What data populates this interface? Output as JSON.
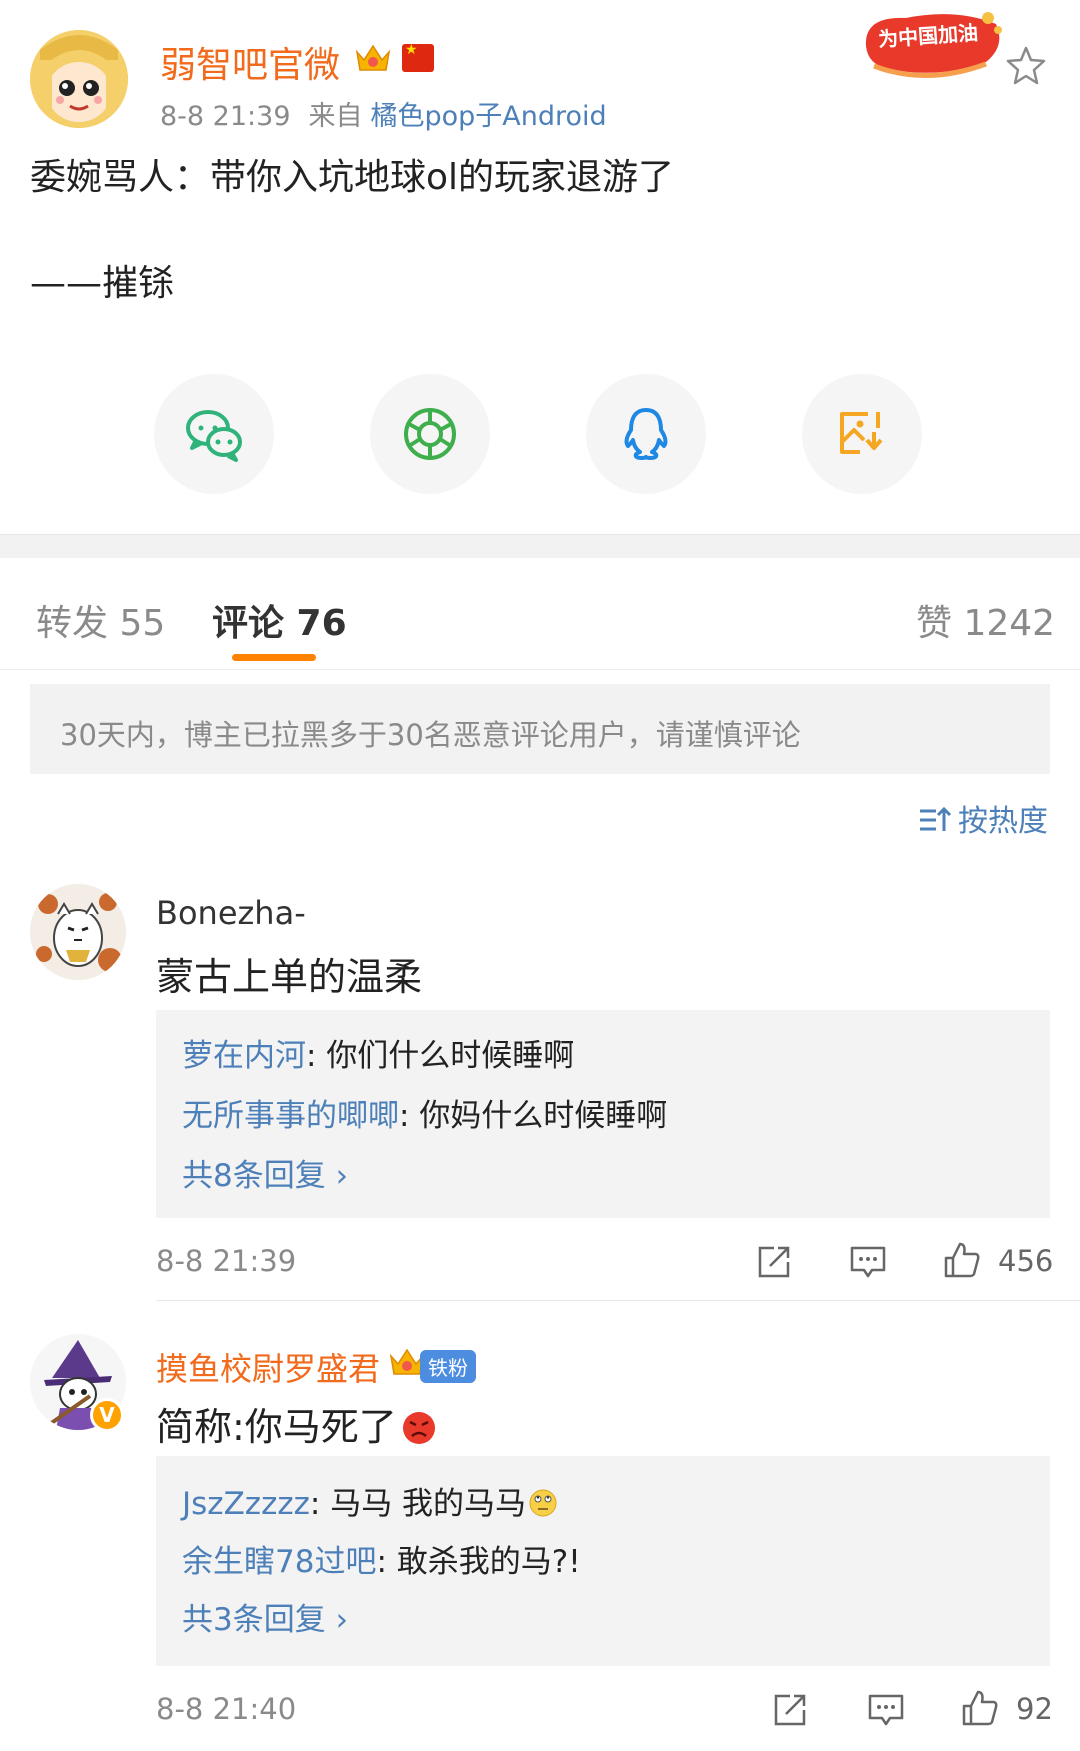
{
  "post": {
    "author_name": "弱智吧官微",
    "date": "8-8 21:39",
    "from_label": "来自",
    "source": "橘色pop子Android",
    "badge_text": "为中国加油",
    "body": "委婉骂人：带你入坑地球ol的玩家退游了",
    "signature": "——摧铩"
  },
  "share_icons": [
    "wechat-icon",
    "moments-icon",
    "qq-icon",
    "save-image-icon"
  ],
  "tabs": {
    "repost": "转发 55",
    "comments": "评论 76",
    "likes": "赞 1242"
  },
  "notice": "30天内，博主已拉黑多于30名恶意评论用户，请谨慎评论",
  "sort_label": "按热度",
  "comments": [
    {
      "user": "Bonezha-",
      "text": "蒙古上单的温柔",
      "replies": [
        {
          "user": "萝在内河",
          "sep": ": ",
          "text": "你们什么时候睡啊"
        },
        {
          "user": "无所事事的唧唧",
          "sep": ": ",
          "text": "你妈什么时候睡啊"
        }
      ],
      "more": "共8条回复 ›",
      "time": "8-8 21:39",
      "likes": "456"
    },
    {
      "user": "摸鱼校尉罗盛君",
      "fan_badge": "铁粉",
      "text": "简称:你马死了",
      "replies": [
        {
          "user": "JszZzzzz",
          "sep": ": ",
          "text": "马马 我的马马"
        },
        {
          "user": "余生瞎78过吧",
          "sep": ": ",
          "text": "敢杀我的马?!"
        }
      ],
      "more": "共3条回复 ›",
      "time": "8-8 21:40",
      "likes": "92"
    }
  ],
  "colors": {
    "brand_orange": "#ff8200",
    "author_orange": "#f26a1b",
    "link_blue": "#4d7fb8"
  }
}
